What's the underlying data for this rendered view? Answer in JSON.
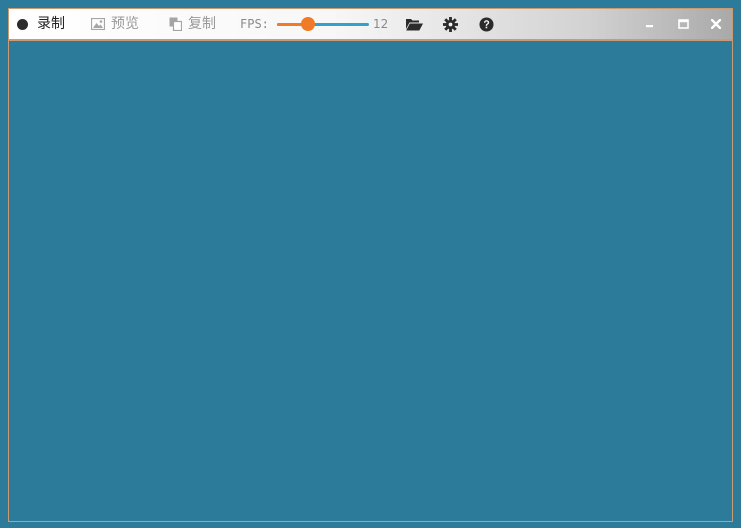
{
  "toolbar": {
    "record_label": "录制",
    "preview_label": "预览",
    "copy_label": "复制",
    "fps_label": "FPS:",
    "fps_value": "12",
    "fps_slider_fraction": 0.34
  },
  "icons": {
    "record": "record-dot-icon",
    "preview": "image-icon",
    "copy": "copy-icon",
    "open": "folder-open-icon",
    "settings": "gear-icon",
    "help": "help-icon",
    "minimize": "minimize-icon",
    "maximize": "maximize-icon",
    "close": "close-icon"
  },
  "colors": {
    "background": "#2c7b9a",
    "border": "#c99a74",
    "slider_track": "#2fa3cf",
    "slider_fill": "#f07a25"
  }
}
